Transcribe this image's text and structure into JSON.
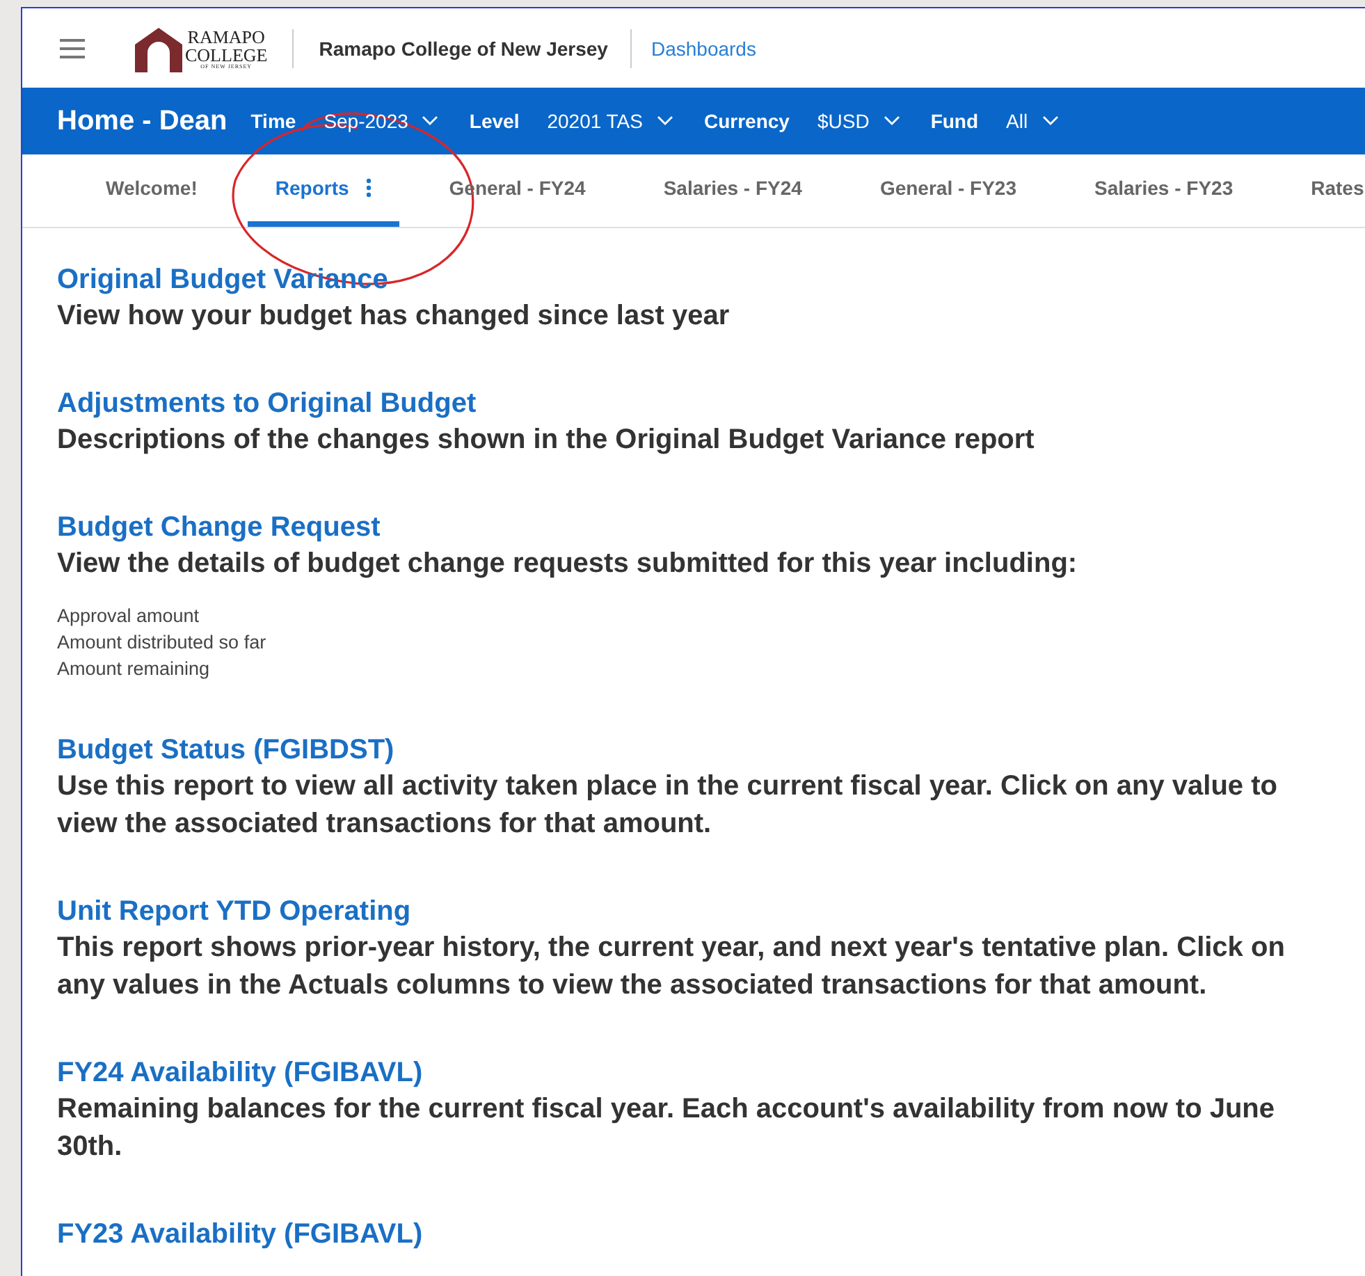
{
  "header": {
    "logo_lines": [
      "RAMAPO",
      "COLLEGE",
      "OF NEW JERSEY"
    ],
    "organization": "Ramapo College of New Jersey",
    "link": "Dashboards"
  },
  "toolbar": {
    "title": "Home - Dean",
    "filters": [
      {
        "label": "Time",
        "value": "Sep-2023"
      },
      {
        "label": "Level",
        "value": "20201 TAS"
      },
      {
        "label": "Currency",
        "value": "$USD"
      },
      {
        "label": "Fund",
        "value": "All"
      }
    ]
  },
  "tabs": [
    {
      "label": "Welcome!",
      "selected": false
    },
    {
      "label": "Reports",
      "selected": true
    },
    {
      "label": "General - FY24",
      "selected": false
    },
    {
      "label": "Salaries - FY24",
      "selected": false
    },
    {
      "label": "General - FY23",
      "selected": false
    },
    {
      "label": "Salaries - FY23",
      "selected": false
    },
    {
      "label": "Rates",
      "selected": false
    }
  ],
  "sections": [
    {
      "title": "Original Budget Variance",
      "description": "View how your budget has changed since last year"
    },
    {
      "title": "Adjustments to Original Budget",
      "description": "Descriptions of the changes shown in the Original Budget Variance report"
    },
    {
      "title": "Budget Change Request",
      "description": "View the details of budget change requests submitted for this year including:",
      "items": [
        "Approval amount",
        "Amount distributed so far",
        "Amount remaining"
      ]
    },
    {
      "title": "Budget Status (FGIBDST)",
      "description": "Use this report to view all activity taken place in the current fiscal year. Click on any value to view the associated transactions for that amount."
    },
    {
      "title": "Unit Report YTD Operating",
      "description": "This report shows prior-year history, the current year, and next year's tentative plan. Click on any values in the Actuals columns to view the associated transactions for that amount."
    },
    {
      "title": "FY24 Availability (FGIBAVL)",
      "description": "Remaining balances for the current fiscal year. Each account's availability from now to June 30th."
    },
    {
      "title": "FY23 Availability (FGIBAVL)"
    }
  ]
}
